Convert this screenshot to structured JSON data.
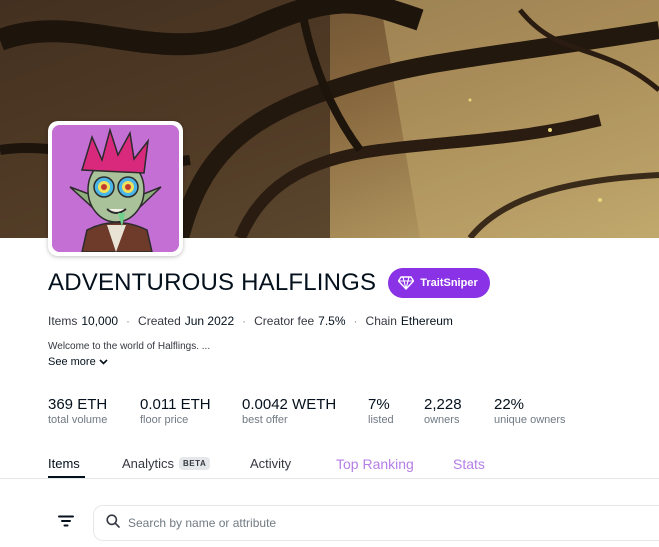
{
  "collection": {
    "name": "ADVENTUROUS HALFLINGS",
    "badge_label": "TraitSniper",
    "meta": {
      "items_label": "Items",
      "items_value": "10,000",
      "created_label": "Created",
      "created_value": "Jun 2022",
      "fee_label": "Creator fee",
      "fee_value": "7.5%",
      "chain_label": "Chain",
      "chain_value": "Ethereum"
    },
    "description": "Welcome to the world of Halflings. ...",
    "see_more": "See more"
  },
  "stats": [
    {
      "value": "369 ETH",
      "label": "total volume"
    },
    {
      "value": "0.011 ETH",
      "label": "floor price"
    },
    {
      "value": "0.0042 WETH",
      "label": "best offer"
    },
    {
      "value": "7%",
      "label": "listed"
    },
    {
      "value": "2,228",
      "label": "owners"
    },
    {
      "value": "22%",
      "label": "unique owners"
    }
  ],
  "tabs": {
    "items": "Items",
    "analytics": "Analytics",
    "analytics_badge": "BETA",
    "activity": "Activity",
    "top_ranking": "Top Ranking",
    "stats": "Stats"
  },
  "search": {
    "placeholder": "Search by name or attribute"
  },
  "colors": {
    "accent_purple": "#8a32e6",
    "link_purple": "#b57ee6",
    "text_dark": "#04111d"
  },
  "icons": [
    "diamond-icon",
    "chevron-down-icon",
    "filter-icon",
    "search-icon"
  ]
}
